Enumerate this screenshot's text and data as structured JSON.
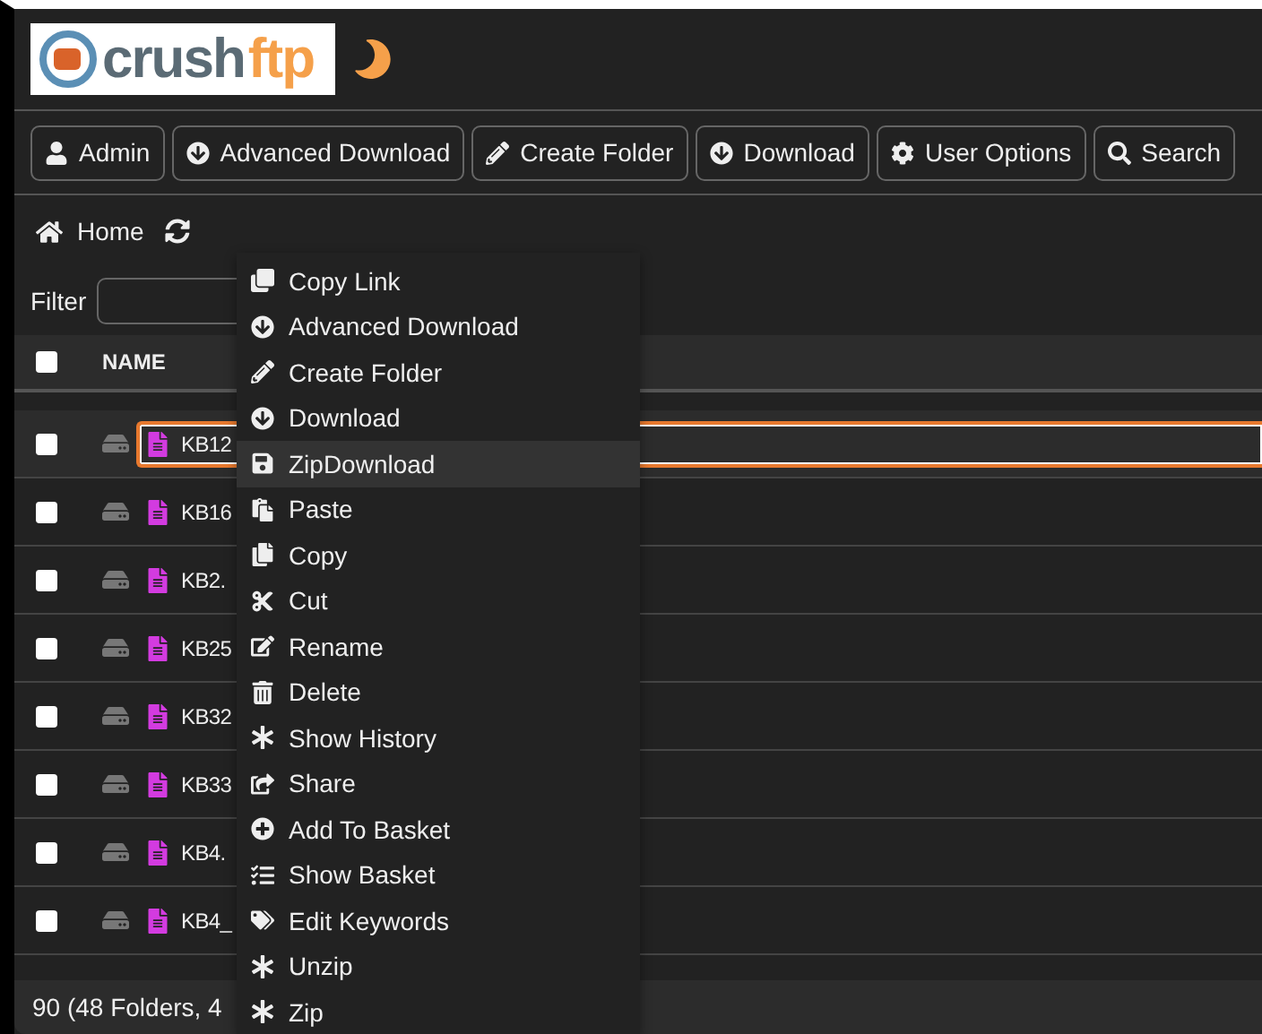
{
  "logo": {
    "word": "crush",
    "accent": "ftp"
  },
  "toolbar": [
    "Admin",
    "Advanced Download",
    "Create Folder",
    "Download",
    "User Options",
    "Search"
  ],
  "breadcrumb": {
    "home": "Home"
  },
  "filter": {
    "label": "Filter"
  },
  "table": {
    "columns": [
      "NAME"
    ],
    "header_checked": false,
    "rows": [
      {
        "name": "KB12",
        "selected": true,
        "checked": false
      },
      {
        "name": "KB16",
        "selected": false,
        "checked": false
      },
      {
        "name": "KB2.",
        "selected": false,
        "checked": false
      },
      {
        "name": "KB25",
        "selected": false,
        "checked": false
      },
      {
        "name": "KB32",
        "selected": false,
        "checked": false
      },
      {
        "name": "KB33",
        "selected": false,
        "checked": false
      },
      {
        "name": "KB4.",
        "selected": false,
        "checked": false
      },
      {
        "name": "KB4_",
        "selected": false,
        "checked": false
      }
    ]
  },
  "status_bar": "90 (48 Folders, 4",
  "context_menu": [
    {
      "label": "Copy Link",
      "selected": false
    },
    {
      "label": "Advanced Download",
      "selected": false
    },
    {
      "label": "Create Folder",
      "selected": false
    },
    {
      "label": "Download",
      "selected": false
    },
    {
      "label": "ZipDownload",
      "selected": true
    },
    {
      "label": "Paste",
      "selected": false
    },
    {
      "label": "Copy",
      "selected": false
    },
    {
      "label": "Cut",
      "selected": false
    },
    {
      "label": "Rename",
      "selected": false
    },
    {
      "label": "Delete",
      "selected": false
    },
    {
      "label": "Show History",
      "selected": false
    },
    {
      "label": "Share",
      "selected": false
    },
    {
      "label": "Add To Basket",
      "selected": false
    },
    {
      "label": "Show Basket",
      "selected": false
    },
    {
      "label": "Edit Keywords",
      "selected": false
    },
    {
      "label": "Unzip",
      "selected": false
    },
    {
      "label": "Zip",
      "selected": false
    }
  ]
}
